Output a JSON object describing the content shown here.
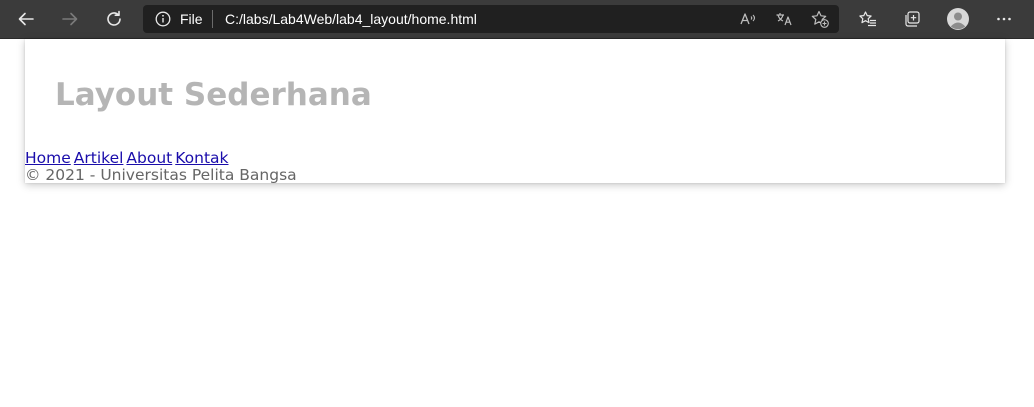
{
  "browser": {
    "address": {
      "scheme_label": "File",
      "url": "C:/labs/Lab4Web/lab4_layout/home.html"
    },
    "icons": {
      "back": "arrow-left-icon",
      "forward": "arrow-right-icon",
      "refresh": "refresh-icon",
      "info": "info-icon",
      "read_aloud": "read-aloud-icon",
      "translate": "translate-icon",
      "add_favorite": "add-favorite-icon",
      "favorites": "favorites-icon",
      "collections": "collections-icon",
      "profile": "profile-avatar-icon",
      "more": "more-options-icon"
    },
    "colors": {
      "toolbar_bg": "#3b3b3b",
      "address_bg": "#202020"
    }
  },
  "page": {
    "title": "Layout Sederhana",
    "nav": [
      {
        "label": "Home"
      },
      {
        "label": "Artikel"
      },
      {
        "label": "About"
      },
      {
        "label": "Kontak"
      }
    ],
    "footer": "© 2021 - Universitas Pelita Bangsa",
    "colors": {
      "title": "#b5b5b5",
      "link": "#1a0dab",
      "footer_text": "#666666"
    }
  }
}
